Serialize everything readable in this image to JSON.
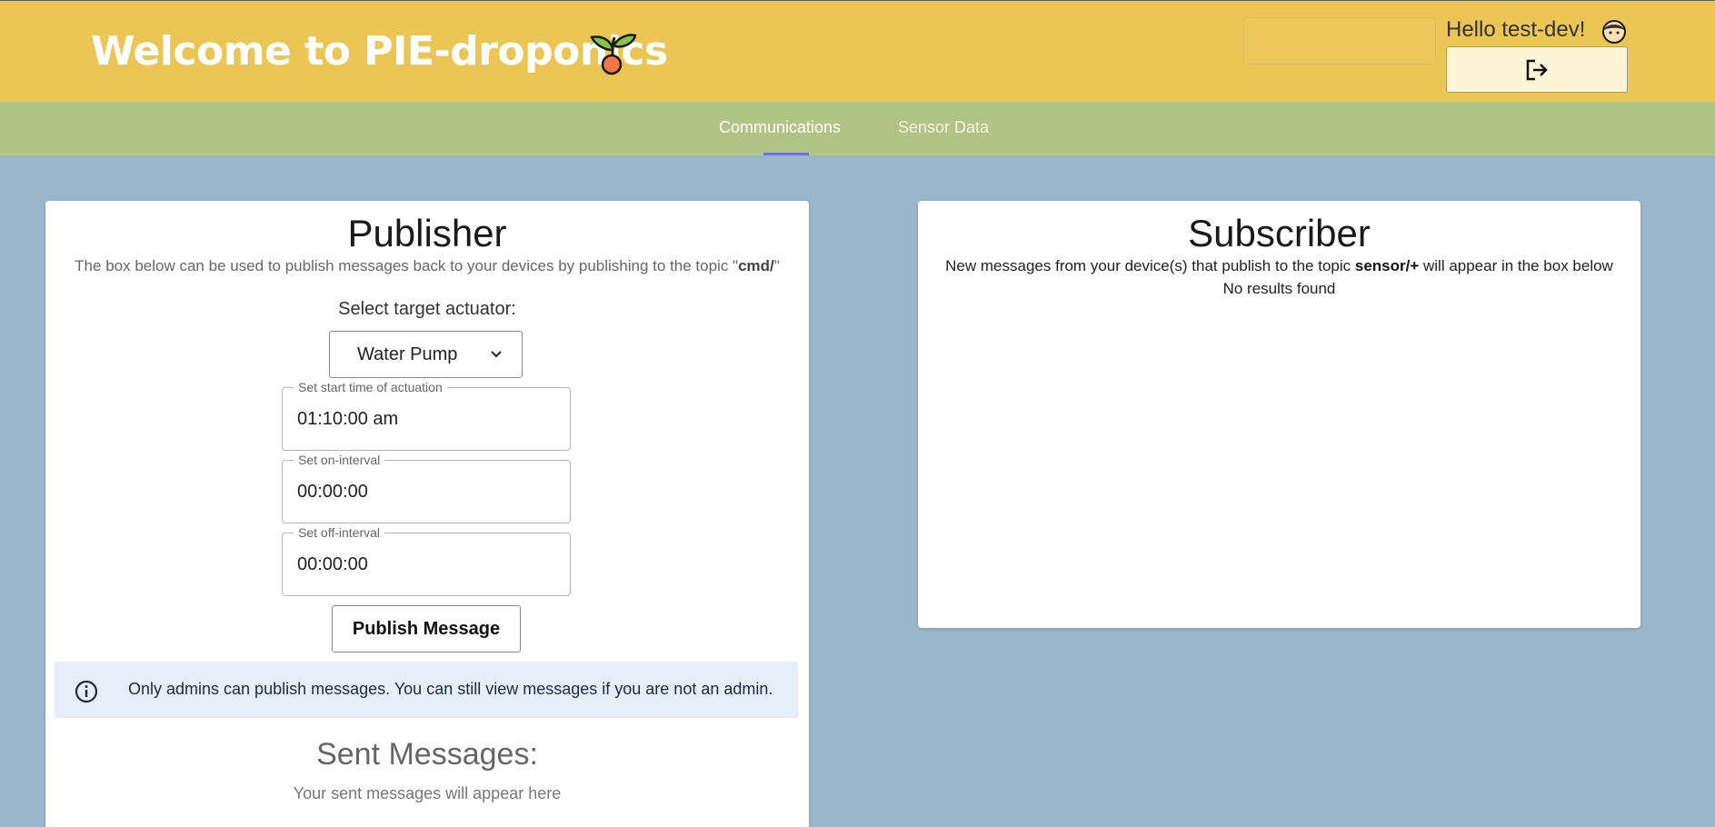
{
  "header": {
    "title": "Welcome to PIE-droponics",
    "greeting": "Hello test-dev!",
    "logout_icon": "logout-icon",
    "logo_icon": "sprout-icon",
    "avatar_icon": "avatar-icon",
    "colors": {
      "header_bg": "#ecc655",
      "nav_bg": "#b0c585",
      "page_bg": "#9ab6cc",
      "tab_indicator": "#7070d8"
    }
  },
  "nav": {
    "tabs": [
      {
        "label": "Communications",
        "active": true
      },
      {
        "label": "Sensor Data",
        "active": false
      }
    ]
  },
  "publisher": {
    "heading": "Publisher",
    "description_prefix": "The box below can be used to publish messages back to your devices by publishing to the topic \"",
    "description_topic": "cmd/",
    "description_suffix": "\"",
    "select_label": "Select target actuator:",
    "selected_actuator": "Water Pump",
    "fields": {
      "start": {
        "label": "Set start time of actuation",
        "value": "01:10:00 am"
      },
      "on_interval": {
        "label": "Set on-interval",
        "value": "00:00:00"
      },
      "off_interval": {
        "label": "Set off-interval",
        "value": "00:00:00"
      }
    },
    "publish_button": "Publish Message",
    "alert": "Only admins can publish messages. You can still view messages if you are not an admin.",
    "sent_heading": "Sent Messages:",
    "sent_empty": "Your sent messages will appear here"
  },
  "subscriber": {
    "heading": "Subscriber",
    "description_prefix": "New messages from your device(s) that publish to the topic ",
    "description_topic": "sensor/+",
    "description_suffix": " will appear in the box below",
    "no_results": "No results found"
  }
}
